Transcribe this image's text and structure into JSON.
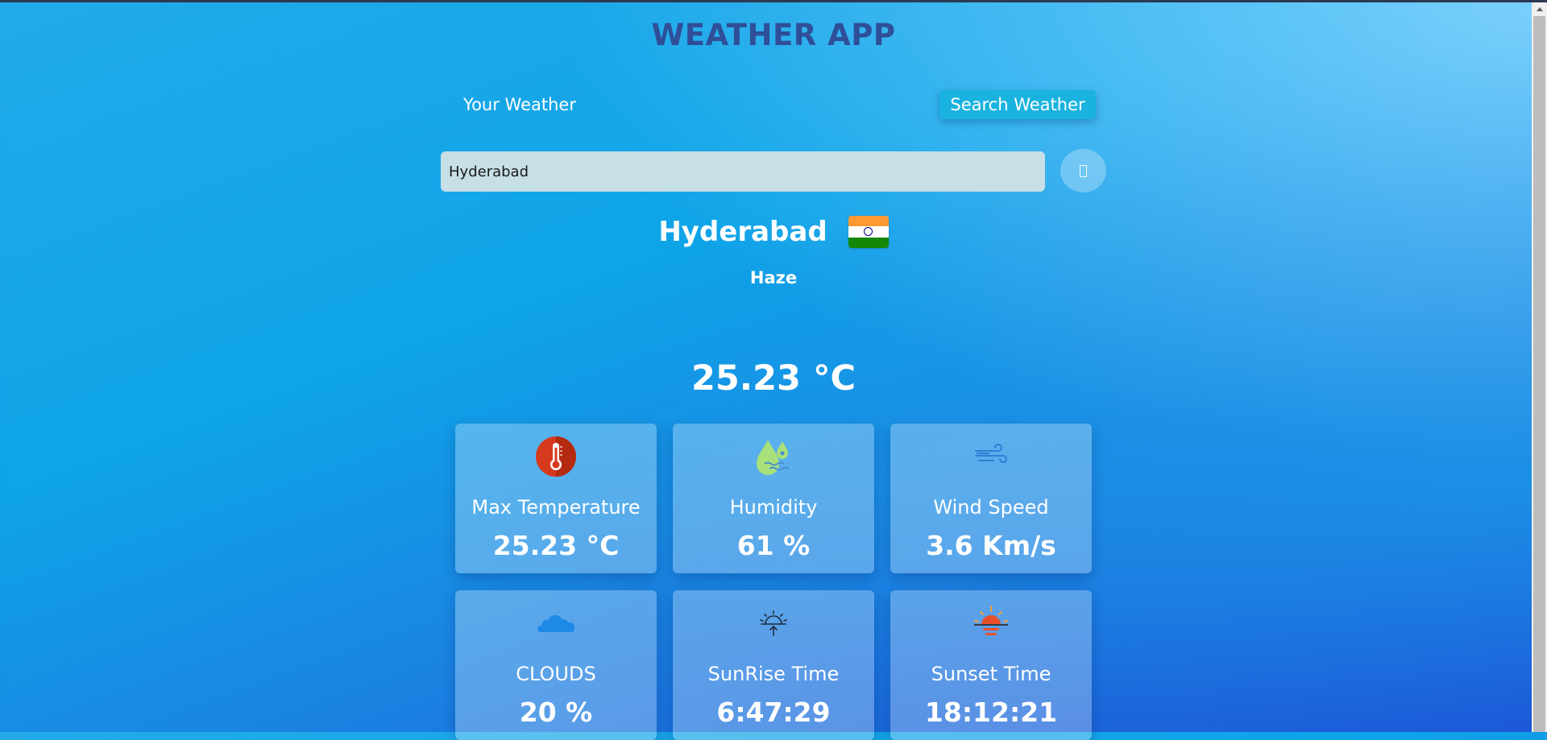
{
  "header": {
    "title": "WEATHER APP"
  },
  "tabs": {
    "your_weather": "Your Weather",
    "search_weather": "Search Weather"
  },
  "search": {
    "value": "Hyderabad",
    "button_glyph": "search-icon"
  },
  "location": {
    "city": "Hyderabad",
    "flag": "india-flag",
    "condition": "Haze"
  },
  "current": {
    "temperature": "25.23 °C"
  },
  "cards": [
    {
      "icon": "thermometer-icon",
      "label": "Max Temperature",
      "value": "25.23 °C"
    },
    {
      "icon": "humidity-icon",
      "label": "Humidity",
      "value": "61 %"
    },
    {
      "icon": "wind-icon",
      "label": "Wind Speed",
      "value": "3.6 Km/s"
    },
    {
      "icon": "cloud-icon",
      "label": "CLOUDS",
      "value": "20 %"
    },
    {
      "icon": "sunrise-icon",
      "label": "SunRise Time",
      "value": "6:47:29"
    },
    {
      "icon": "sunset-icon",
      "label": "Sunset Time",
      "value": "18:12:21"
    }
  ],
  "colors": {
    "title": "#2f4f98",
    "search_tab": "#1ab3e0",
    "input_bg": "#c7dfe6"
  }
}
